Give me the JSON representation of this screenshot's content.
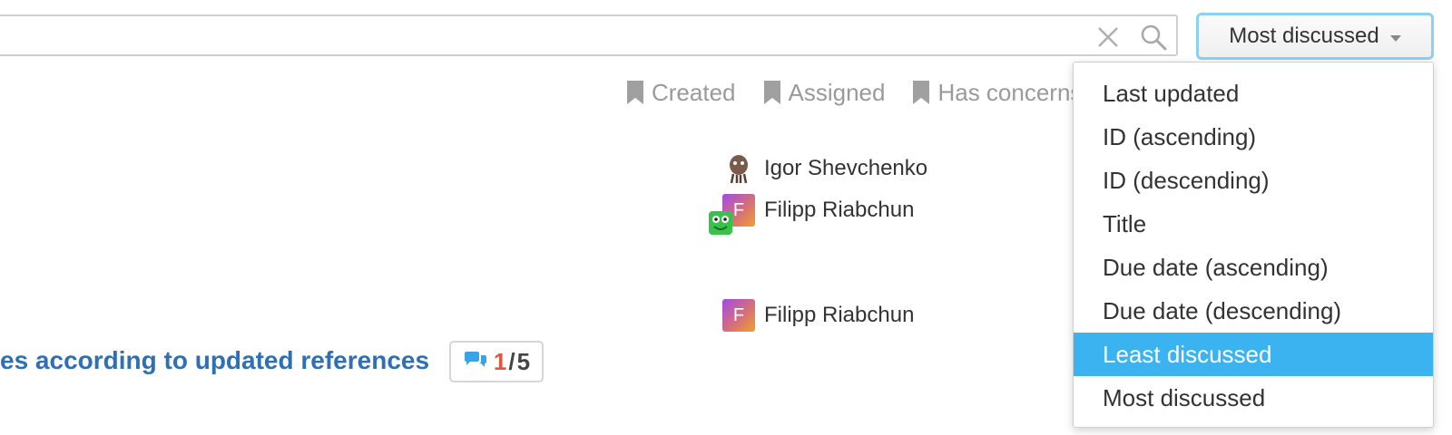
{
  "search": {
    "value": "",
    "placeholder": ""
  },
  "sort_button": {
    "label": "Most discussed"
  },
  "filters": [
    {
      "label": "Created"
    },
    {
      "label": "Assigned"
    },
    {
      "label": "Has concerns"
    }
  ],
  "users": [
    {
      "name": "Igor Shevchenko"
    },
    {
      "name": "Filipp Riabchun",
      "initial": "F"
    },
    {
      "name": "Filipp Riabchun",
      "initial": "F"
    }
  ],
  "issue": {
    "title": "es according to updated references",
    "comments_new": "1",
    "comments_separator": "/",
    "comments_total": "5"
  },
  "sort_menu": {
    "items": [
      {
        "label": "Last updated",
        "active": false
      },
      {
        "label": "ID (ascending)",
        "active": false
      },
      {
        "label": "ID (descending)",
        "active": false
      },
      {
        "label": "Title",
        "active": false
      },
      {
        "label": "Due date (ascending)",
        "active": false
      },
      {
        "label": "Due date (descending)",
        "active": false
      },
      {
        "label": "Least discussed",
        "active": true
      },
      {
        "label": "Most discussed",
        "active": false
      }
    ]
  },
  "colors": {
    "link": "#2f6fb4",
    "highlight": "#3bb3f0",
    "comment_new": "#e8533c",
    "focus_border": "#8cd0f2"
  },
  "icons": [
    "clear-icon",
    "search-icon",
    "bookmark-icon",
    "comments-icon",
    "chevron-down-icon"
  ]
}
